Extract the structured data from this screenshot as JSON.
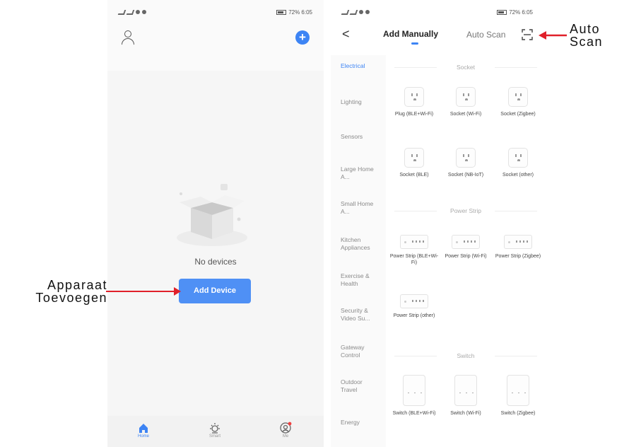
{
  "left_screen": {
    "status_left": "4G 4G",
    "status_right": "72% 6:05",
    "plus_glyph": "+",
    "empty_text": "No devices",
    "add_device_label": "Add Device",
    "tabs": [
      {
        "label": "Home",
        "icon": "home-icon"
      },
      {
        "label": "Smart",
        "icon": "sun-icon"
      },
      {
        "label": "Me",
        "icon": "profile-icon"
      }
    ]
  },
  "right_screen": {
    "status_left": "4G 4G",
    "status_right": "72% 6:05",
    "back_glyph": "<",
    "tab_manual": "Add Manually",
    "tab_auto": "Auto Scan",
    "categories": [
      "Electrical",
      "Lighting",
      "Sensors",
      "Large Home A...",
      "Small Home A...",
      "Kitchen Appliances",
      "Exercise & Health",
      "Security & Video Su...",
      "Gateway Control",
      "Outdoor Travel",
      "Energy"
    ],
    "sections": {
      "socket": "Socket",
      "power_strip": "Power Strip",
      "switch": "Switch"
    },
    "devices": {
      "socket": [
        "Plug (BLE+Wi-Fi)",
        "Socket (Wi-Fi)",
        "Socket (Zigbee)",
        "Socket (BLE)",
        "Socket (NB-IoT)",
        "Socket (other)"
      ],
      "power_strip": [
        "Power Strip (BLE+Wi-Fi)",
        "Power Strip (Wi-Fi)",
        "Power Strip (Zigbee)",
        "Power Strip (other)"
      ],
      "switch": [
        "Switch (BLE+Wi-Fi)",
        "Switch (Wi-Fi)",
        "Switch (Zigbee)"
      ]
    }
  },
  "annotations": {
    "left": "Apparaat Toevoegen",
    "right": "Auto Scan"
  },
  "colors": {
    "accent": "#3d84f4",
    "button": "#4f90f5",
    "arrow": "#e0202a"
  }
}
